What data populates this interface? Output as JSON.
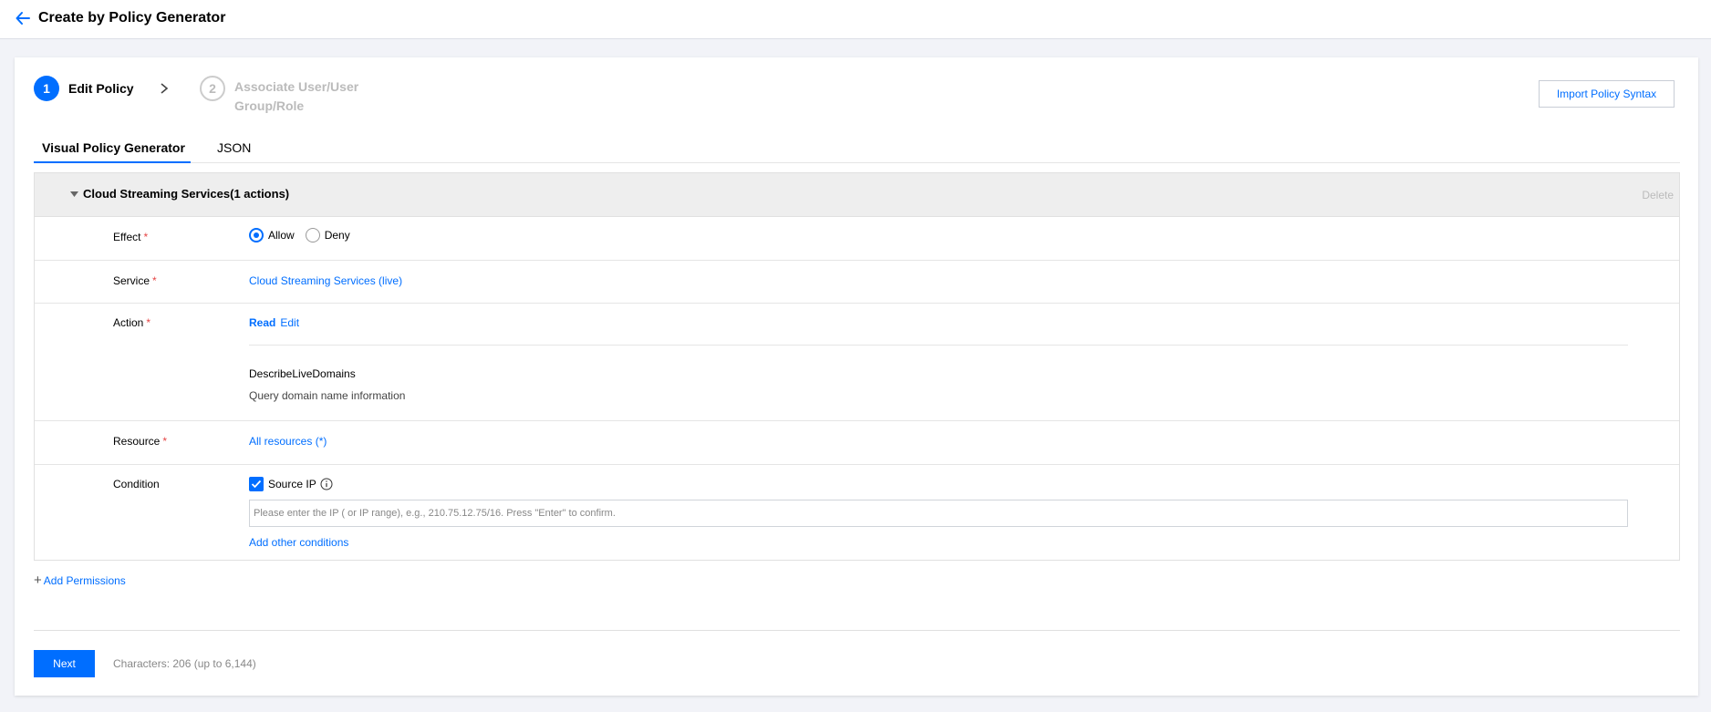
{
  "header": {
    "title": "Create by Policy Generator",
    "back_icon": "arrow-left-icon"
  },
  "steps": [
    {
      "number": "1",
      "label": "Edit Policy",
      "state": "active"
    },
    {
      "number": "2",
      "label": "Associate User/User Group/Role",
      "state": "inactive"
    }
  ],
  "toolbar": {
    "import_label": "Import Policy Syntax"
  },
  "tabs": [
    {
      "label": "Visual Policy Generator",
      "active": true
    },
    {
      "label": "JSON",
      "active": false
    }
  ],
  "statement": {
    "title": "Cloud Streaming Services(1 actions)",
    "delete_label": "Delete",
    "effect": {
      "label": "Effect",
      "required_mark": "*",
      "options": [
        {
          "label": "Allow",
          "selected": true
        },
        {
          "label": "Deny",
          "selected": false
        }
      ]
    },
    "service": {
      "label": "Service",
      "required_mark": "*",
      "value": "Cloud Streaming Services (live)"
    },
    "action": {
      "label": "Action",
      "required_mark": "*",
      "access_level": "Read",
      "edit_label": "Edit",
      "items": [
        {
          "name": "DescribeLiveDomains",
          "description": "Query domain name information"
        }
      ]
    },
    "resource": {
      "label": "Resource",
      "required_mark": "*",
      "value": "All resources (*)"
    },
    "condition": {
      "label": "Condition",
      "source_ip_label": "Source IP",
      "source_ip_checked": true,
      "ip_placeholder": "Please enter the IP ( or IP range), e.g., 210.75.12.75/16. Press \"Enter\" to confirm.",
      "ip_value": "",
      "add_label": "Add other conditions"
    }
  },
  "add_permissions_label": "Add Permissions",
  "footer": {
    "next_label": "Next",
    "char_count": "Characters: 206 (up to 6,144)"
  },
  "colors": {
    "accent": "#006eff",
    "page_bg": "#f2f3f8",
    "required": "#e54545"
  }
}
